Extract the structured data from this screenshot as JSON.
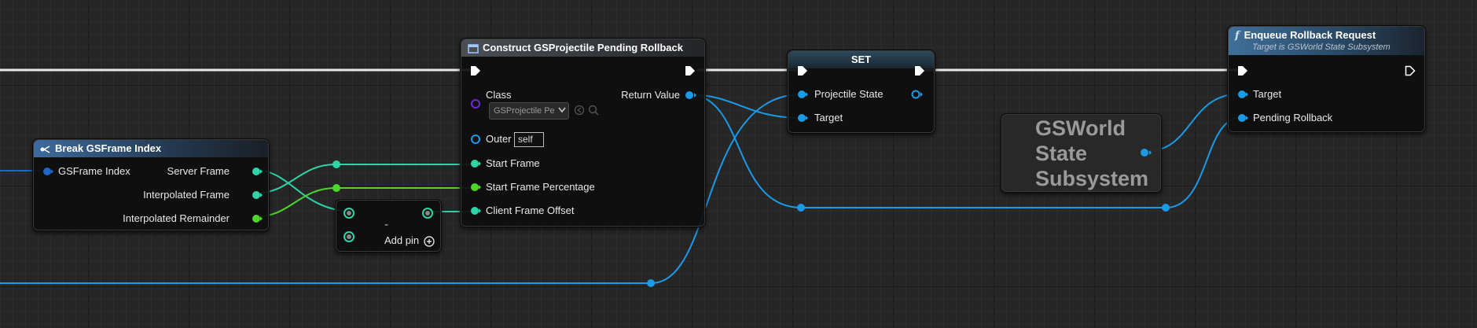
{
  "nodes": {
    "break_index": {
      "title": "Break GSFrame Index",
      "input_pin": "GSFrame Index",
      "outputs": [
        "Server Frame",
        "Interpolated Frame",
        "Interpolated Remainder"
      ]
    },
    "add_node": {
      "operator": "-",
      "add_pin_label": "Add pin"
    },
    "construct": {
      "title": "Construct GSProjectile Pending Rollback",
      "class_label": "Class",
      "class_value": "GSProjectile Pe",
      "return_value": "Return Value",
      "outer_label": "Outer",
      "outer_value": "self",
      "inputs": [
        "Start Frame",
        "Start Frame Percentage",
        "Client Frame Offset"
      ]
    },
    "set": {
      "title": "SET",
      "pins": [
        "Projectile State",
        "Target"
      ]
    },
    "subsystem": {
      "lines": [
        "GSWorld",
        "State",
        "Subsystem"
      ]
    },
    "enqueue": {
      "title": "Enqueue Rollback Request",
      "subtitle": "Target is GSWorld State Subsystem",
      "pins": [
        "Target",
        "Pending Rollback"
      ]
    }
  },
  "colors": {
    "exec": "#ffffff",
    "object": "#1b9ae8",
    "integer": "#2ed3a6",
    "float": "#4cd62a",
    "class": "#6a2bd6"
  }
}
